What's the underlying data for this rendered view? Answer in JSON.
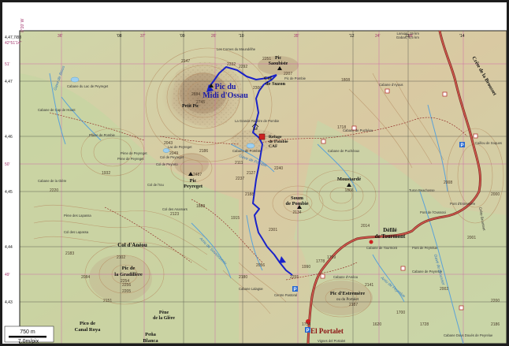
{
  "corner": {
    "lon_tl": "4,47,7/88",
    "lat_tl": "42°51'14\"",
    "lon_tl2": "0°20' W"
  },
  "edge_ticks_top": [
    "36'",
    "'08",
    "37'",
    "'09",
    "26'",
    "'10",
    "35'",
    "'12",
    "24'",
    "'13",
    "38'",
    "'14"
  ],
  "edge_ticks_left": [
    "51'",
    "4,47",
    "4,46",
    "50'",
    "4,45",
    "4,44",
    "49'",
    "4,43"
  ],
  "destination": {
    "line1": "Laruns, 19 km",
    "line2": "Gabas, 6,5 km"
  },
  "summits": [
    {
      "name_l1": "Pic du",
      "name_l2": "Midi d'Ossau",
      "elev": "2884"
    },
    {
      "name_l1": "Petit Pic",
      "name_l2": "",
      "elev": ""
    },
    {
      "name_l1": "Pic",
      "name_l2": "Saoubiste",
      "elev": ""
    },
    {
      "name_l1": "Col",
      "name_l2": "de Suzon",
      "elev": ""
    },
    {
      "name_l1": "Pic",
      "name_l2": "Peyreget",
      "elev": "2487"
    },
    {
      "name_l1": "Moustardé",
      "name_l2": "",
      "elev": "1866"
    },
    {
      "name_l1": "Soum",
      "name_l2": "de Pombie",
      "elev": "2134"
    },
    {
      "name_l1": "Col d'Anéou",
      "name_l2": "",
      "elev": ""
    },
    {
      "name_l1": "Pic de",
      "name_l2": "la Gradillère",
      "elev": ""
    },
    {
      "name_l1": "Pic d'Estremère",
      "name_l2": "ou du Portalet",
      "elev": ""
    },
    {
      "name_l1": "Pène",
      "name_l2": "de la Glère",
      "elev": ""
    },
    {
      "name_l1": "Pico de",
      "name_l2": "Canal Roya",
      "elev": ""
    },
    {
      "name_l1": "Peña",
      "name_l2": "Blanca",
      "elev": ""
    },
    {
      "name_l1": "Défilé",
      "name_l2": "de Tourmont",
      "elev": ""
    },
    {
      "name_l1": "El Portalet",
      "name_l2": "",
      "elev": ""
    }
  ],
  "refuge": {
    "l1": "Refuge",
    "l2": "de Pombie",
    "l3": "CAF"
  },
  "small_labels": [
    "Les Cornes du Moundélhe",
    "Pic de Pombie",
    "Cabane d'Ayous",
    "Cabane du Lac de Peyreget",
    "Cabane de Cap de Hount",
    "Col de Peyreget",
    "Pène de Peyreget",
    "Col de l'Iou",
    "Col des Anamars",
    "Cabane de Puchéoux",
    "Cabane de Puchéou",
    "Cabane de la Glère",
    "Pène des Lapassa",
    "Col des Lapassa",
    "Cabane de Tourmont",
    "Pont de Peyrelue",
    "Cabane de Peyrelue",
    "Cabane d'Anéou",
    "Centre Pastoral",
    "Cabane Lalagüe",
    "Cabane Dous Doués de Peyrelue",
    "Vignes del Portalet",
    "Caillou de Soques",
    "Pont d'Estremère",
    "Col de Peyreto",
    "La Grande Raillère de Pombie",
    "Pène de Peyreget",
    "Pic Peyreget",
    "Turon Beachosse",
    "Pont de l'Oussoüi",
    "Cabane de Pombie",
    "Plaine de Pombie",
    "Lac de Peyreget",
    "Col d'Anéou"
  ],
  "streams": [
    "Gave de Bious",
    "Gave de Pombie",
    "Gave de Brousset",
    "Arriu de Soussoueou",
    "Arriu de Peyrelue"
  ],
  "right_labels": [
    "Crête de la Brousset",
    "Crête Brousset"
  ],
  "elevations": [
    "2745",
    "2251",
    "2207",
    "2292",
    "2300",
    "2123",
    "2102",
    "2147",
    "2332",
    "2111",
    "2127",
    "2188",
    "2301",
    "2240",
    "2049",
    "2237",
    "2186",
    "2043",
    "1718",
    "1932",
    "1888",
    "1915",
    "2056",
    "1990",
    "2014",
    "2255",
    "1778",
    "1799",
    "1754",
    "2000",
    "2001",
    "2008",
    "2141",
    "2187",
    "2200",
    "2002",
    "1808",
    "2256",
    "2205",
    "2151",
    "2084",
    "2183",
    "2254",
    "2180",
    "1700",
    "1728",
    "1620",
    "2186",
    "2220"
  ],
  "scale": {
    "distance": "750 m",
    "resolution": "7.0m/pix"
  },
  "colors": {
    "route": "#1a22c8",
    "road": "#b3423a",
    "water": "#5aa2d8",
    "contour": "#b9946a",
    "terrain_low": "#c9d3a6",
    "terrain_mid": "#d8c7a0",
    "rock": "#a48a6e",
    "grid_magenta": "#cc44aa",
    "grid_black": "#333333"
  }
}
